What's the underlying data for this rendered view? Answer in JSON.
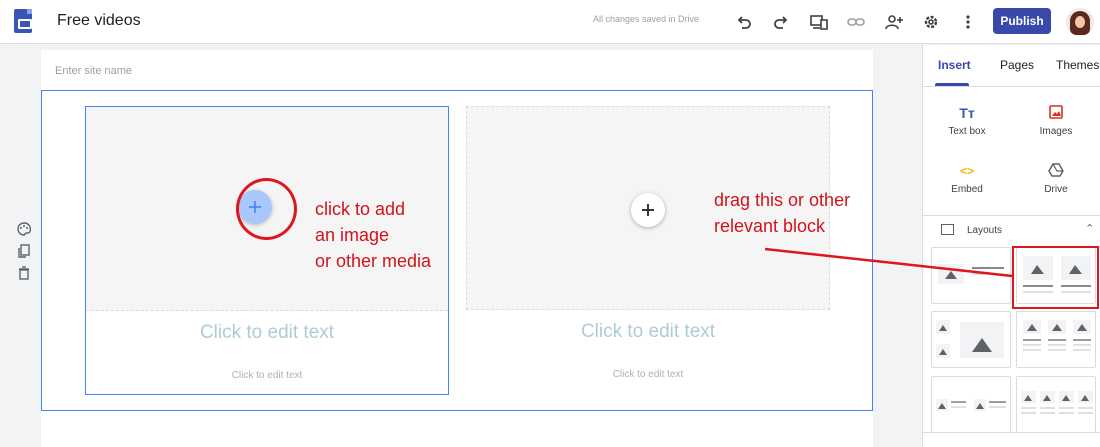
{
  "header": {
    "doc_title": "Free videos",
    "save_status": "All changes saved in Drive",
    "publish_label": "Publish"
  },
  "canvas": {
    "site_name_placeholder": "Enter site name",
    "columns": [
      {
        "edit_title": "Click to edit text",
        "edit_body": "Click to edit text"
      },
      {
        "edit_title": "Click to edit text",
        "edit_body": "Click to edit text"
      }
    ]
  },
  "annotations": {
    "add_media": "click to add\nan image\nor other media",
    "drag_block": "drag this or other\nrelevant block"
  },
  "panel": {
    "tabs": [
      "Insert",
      "Pages",
      "Themes"
    ],
    "insert_items": [
      {
        "label": "Text box",
        "icon": "text-box-icon",
        "glyph": "Tт"
      },
      {
        "label": "Images",
        "icon": "image-icon",
        "glyph": "▣"
      },
      {
        "label": "Embed",
        "icon": "embed-icon",
        "glyph": "<>"
      },
      {
        "label": "Drive",
        "icon": "drive-icon",
        "glyph": "△"
      }
    ],
    "layouts_label": "Layouts"
  },
  "colors": {
    "accent": "#3949ab",
    "selection": "#4285f4",
    "annotation_red": "#e0161e",
    "textbox_icon": "#3c55b5",
    "images_icon": "#d93025",
    "embed_icon": "#f4b400",
    "drive_icon": "#5f6368"
  }
}
